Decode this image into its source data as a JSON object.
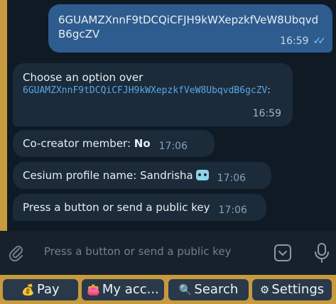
{
  "outgoing": {
    "text": "6GUAMZXnnF9tDCQiCFJH9kWXepzkfVeW8UbqvdB6gcZV",
    "time": "16:59",
    "status": "read"
  },
  "messages": [
    {
      "prefix": "Choose an option over",
      "code": "6GUAMZXnnF9tDCQiCFJH9kWXepzkfVeW8UbqvdB6gcZV",
      "suffix": ":",
      "time": "16:59"
    },
    {
      "label": "Co-creator member: ",
      "value": "No",
      "time": "17:06"
    },
    {
      "text": "Cesium profile name: Sandrisha",
      "emoji": "robot-face",
      "time": "17:06"
    },
    {
      "text": "Press a button or send a public key",
      "time": "17:06"
    }
  ],
  "composer": {
    "placeholder": "Press a button or send a public key"
  },
  "keyboard": {
    "buttons": [
      {
        "emoji": "💰",
        "label": "Pay"
      },
      {
        "emoji": "👛",
        "label": "My acc..."
      },
      {
        "emoji": "🔍",
        "label": "Search"
      },
      {
        "emoji": "⚙",
        "label": "Settings"
      }
    ]
  },
  "colors": {
    "chat_background": "#0f1a25",
    "outgoing_bubble": "#2e5c8e",
    "incoming_bubble": "#1b2b3a",
    "link_mono": "#5ba6e8",
    "frame": "#c79a3e"
  }
}
